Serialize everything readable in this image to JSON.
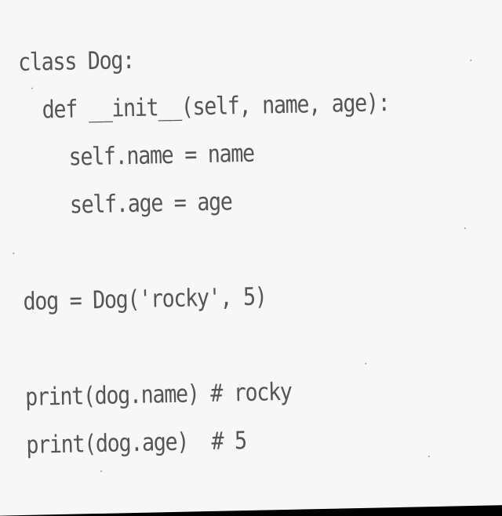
{
  "code": {
    "lines": [
      "class Dog:",
      "def __init__(self, name, age):",
      "self.name = name",
      "self.age = age",
      "dog = Dog('rocky', 5)",
      "print(dog.name) # rocky",
      "print(dog.age)  # 5"
    ]
  }
}
